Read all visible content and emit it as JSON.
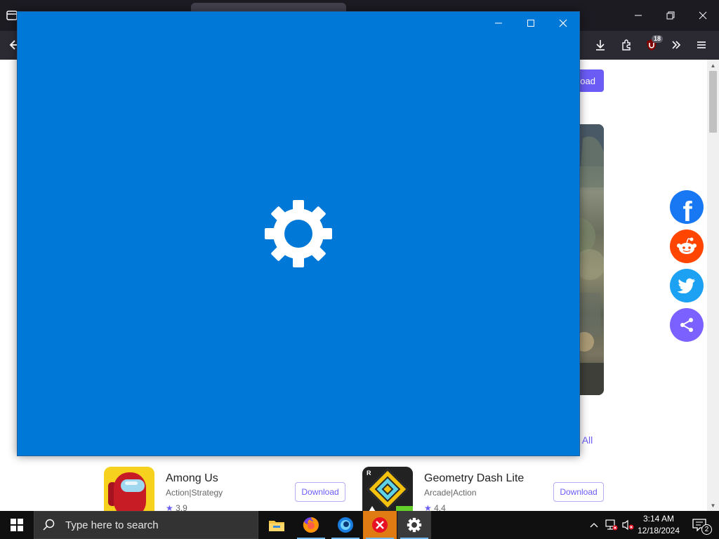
{
  "browser": {
    "download_badge_count": "18"
  },
  "page": {
    "top_download_label": "load",
    "see_all_label": "ee All",
    "apps": [
      {
        "name": "Among Us",
        "category_a": "Action",
        "category_b": "Strategy",
        "rating": "3.9",
        "download_label": "Download"
      },
      {
        "name": "Geometry Dash Lite",
        "category_a": "Arcade",
        "category_b": "Action",
        "rating": "4.4",
        "download_label": "Download"
      }
    ],
    "share_buttons": [
      "facebook-icon",
      "reddit-icon",
      "twitter-icon",
      "share-icon"
    ],
    "colors": {
      "accent": "#6b5cf6",
      "facebook": "#1877f2",
      "reddit": "#ff4500",
      "twitter": "#1da1f2",
      "share": "#7b61ff"
    }
  },
  "settings_window": {
    "background": "#0078d7",
    "icon": "gear-icon"
  },
  "taskbar": {
    "search_placeholder": "Type here to search",
    "time": "3:14 AM",
    "date": "12/18/2024",
    "notification_count": "2"
  }
}
